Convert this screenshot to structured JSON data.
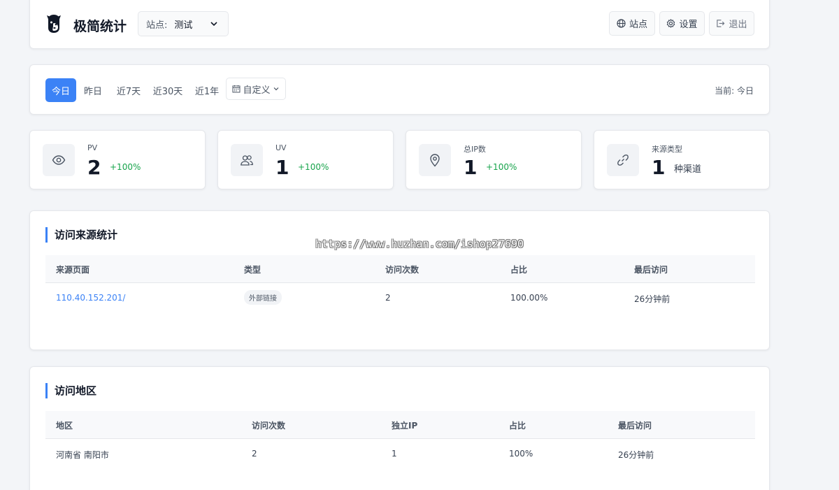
{
  "header": {
    "app_title": "极简统计",
    "site_select": {
      "label": "站点:",
      "value": "测试"
    },
    "buttons": {
      "site": "站点",
      "settings": "设置",
      "logout": "退出"
    }
  },
  "filter": {
    "ranges": [
      "今日",
      "昨日",
      "近7天",
      "近30天",
      "近1年"
    ],
    "active_range": "今日",
    "custom": "自定义",
    "current": "当前: 今日"
  },
  "stats": [
    {
      "label": "PV",
      "value": "2",
      "change": "+100%",
      "icon": "eye-icon"
    },
    {
      "label": "UV",
      "value": "1",
      "change": "+100%",
      "icon": "users-icon"
    },
    {
      "label": "总IP数",
      "value": "1",
      "change": "+100%",
      "icon": "location-pin-icon"
    },
    {
      "label": "来源类型",
      "value": "1",
      "unit": "种渠道",
      "icon": "link-icon"
    }
  ],
  "sources": {
    "title": "访问来源统计",
    "columns": [
      "来源页面",
      "类型",
      "访问次数",
      "占比",
      "最后访问"
    ],
    "rows": [
      {
        "page": "110.40.152.201/",
        "type": "外部链接",
        "visits": "2",
        "ratio": "100.00%",
        "last": "26分钟前"
      }
    ]
  },
  "regions": {
    "title": "访问地区",
    "columns": [
      "地区",
      "访问次数",
      "独立IP",
      "占比",
      "最后访问"
    ],
    "rows": [
      {
        "region": "河南省 南阳市",
        "visits": "2",
        "ips": "1",
        "ratio": "100%",
        "last": "26分钟前"
      }
    ]
  },
  "watermark": "https://www.huzhan.com/ishop27690",
  "colors": {
    "accent": "#3b82f6",
    "positive": "#16a34a",
    "background": "#f3f5f8"
  }
}
